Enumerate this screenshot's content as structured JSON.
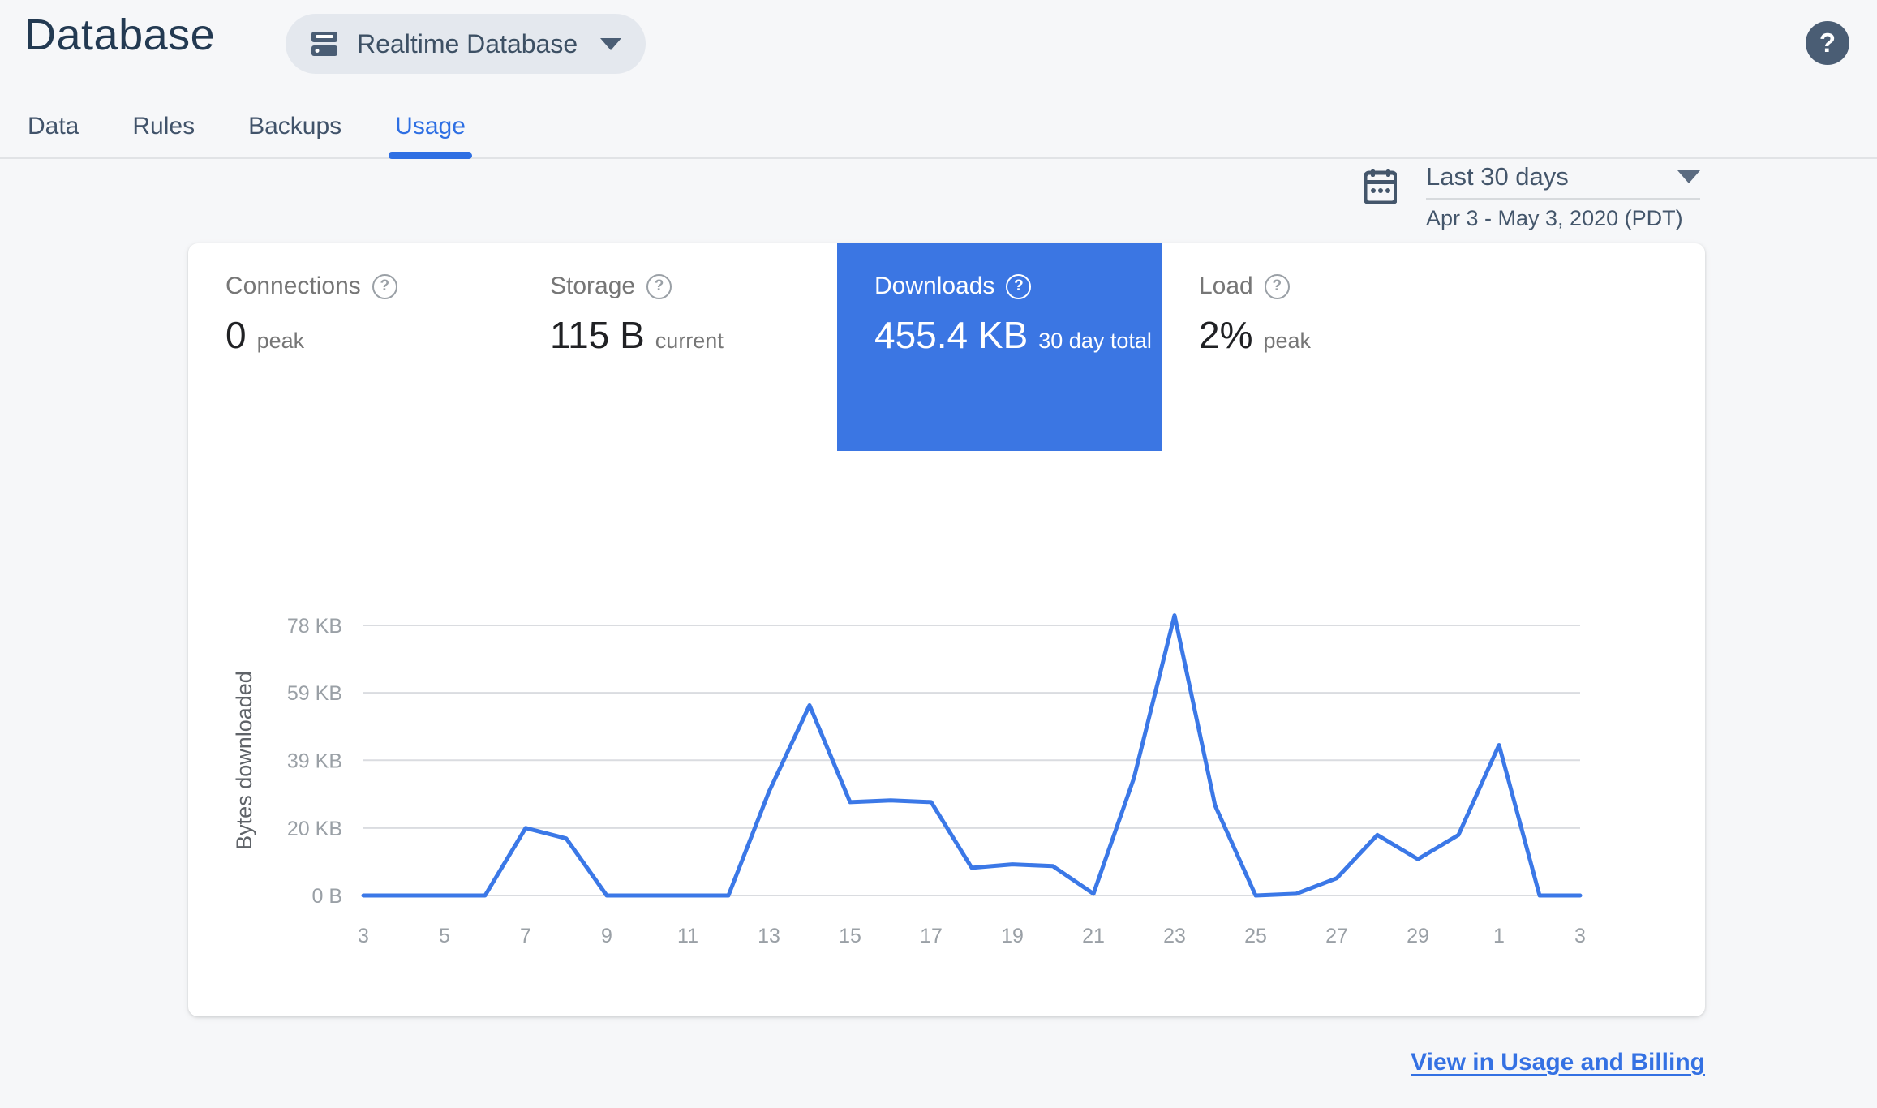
{
  "header": {
    "title": "Database",
    "database_selector": {
      "label": "Realtime Database",
      "icon": "database-icon"
    },
    "help_label": "?"
  },
  "tabs": [
    {
      "label": "Data",
      "active": false
    },
    {
      "label": "Rules",
      "active": false
    },
    {
      "label": "Backups",
      "active": false
    },
    {
      "label": "Usage",
      "active": true
    }
  ],
  "date_range": {
    "icon": "calendar-icon",
    "preset": "Last 30 days",
    "detail": "Apr 3 - May 3, 2020 (PDT)"
  },
  "metrics": [
    {
      "label": "Connections",
      "value": "0",
      "suffix": "peak",
      "selected": false
    },
    {
      "label": "Storage",
      "value": "115 B",
      "suffix": "current",
      "selected": false
    },
    {
      "label": "Downloads",
      "value": "455.4 KB",
      "suffix": "30 day total",
      "selected": true
    },
    {
      "label": "Load",
      "value": "2%",
      "suffix": "peak",
      "selected": false
    }
  ],
  "chart_data": {
    "type": "line",
    "ylabel": "Bytes downloaded",
    "xlabel": "",
    "legend": false,
    "grid": true,
    "x_days": [
      3,
      4,
      5,
      6,
      7,
      8,
      9,
      10,
      11,
      12,
      13,
      14,
      15,
      16,
      17,
      18,
      19,
      20,
      21,
      22,
      23,
      24,
      25,
      26,
      27,
      28,
      29,
      30,
      1,
      2,
      3
    ],
    "x_tick_labels": [
      "3",
      "5",
      "7",
      "9",
      "11",
      "13",
      "15",
      "17",
      "19",
      "21",
      "23",
      "25",
      "27",
      "29",
      "1",
      "3"
    ],
    "y_tick_labels": [
      "0 B",
      "20 KB",
      "39 KB",
      "59 KB",
      "78 KB"
    ],
    "y_tick_values_kb": [
      0,
      19.5,
      39.1,
      58.6,
      78.1
    ],
    "ylim_kb": [
      0,
      87
    ],
    "series": [
      {
        "name": "Bytes downloaded",
        "values_kb": [
          0,
          0,
          0,
          0,
          19.5,
          16.5,
          0,
          0,
          0,
          0,
          30,
          55,
          27,
          27.5,
          27,
          8,
          9,
          8.5,
          0.5,
          34,
          81,
          26,
          0,
          0.5,
          5,
          17.5,
          10.5,
          17.5,
          43.5,
          0,
          0
        ]
      }
    ],
    "line_color": "#3b78e7",
    "grid_color": "#dadce0",
    "tick_color": "#9aa0a6",
    "axis_label_color": "#5f6368"
  },
  "footer": {
    "link_label": "View in Usage and Billing"
  },
  "colors": {
    "accent_blue": "#3b76e3",
    "link_blue": "#3471e3",
    "tab_active_blue": "#2e6fe3",
    "slate": "#44566b",
    "title_navy": "#233a52",
    "label_gray": "#767676",
    "value_dark": "#202124",
    "page_bg": "#f6f7f9",
    "card_bg": "#ffffff"
  }
}
